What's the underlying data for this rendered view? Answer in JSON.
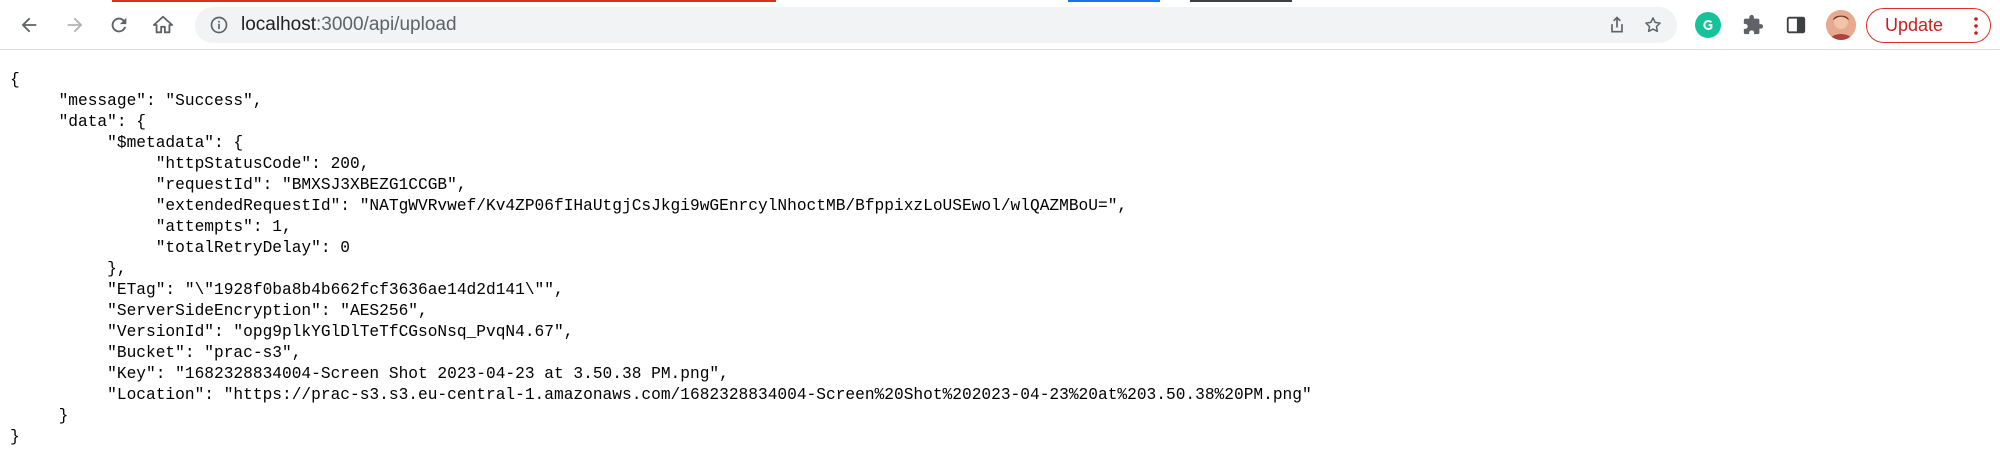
{
  "browser": {
    "url_host": "localhost",
    "url_path": ":3000/api/upload",
    "update_label": "Update",
    "icons": {
      "back": "back-arrow-icon",
      "forward": "forward-arrow-icon",
      "reload": "reload-icon",
      "home": "home-icon",
      "site_info": "info-icon",
      "share": "share-icon",
      "bookmark": "star-icon",
      "grammarly": "grammarly-icon",
      "extensions": "puzzle-icon",
      "side_panel": "side-panel-icon",
      "more": "more-vertical-icon"
    },
    "tab_colors": [
      "#d93025",
      "#1a73e8",
      "#3c4043"
    ]
  },
  "json_lines": [
    "{",
    "     \"message\": \"Success\",",
    "     \"data\": {",
    "          \"$metadata\": {",
    "               \"httpStatusCode\": 200,",
    "               \"requestId\": \"BMXSJ3XBEZG1CCGB\",",
    "               \"extendedRequestId\": \"NATgWVRvwef/Kv4ZP06fIHaUtgjCsJkgi9wGEnrcylNhoctMB/BfppixzLoUSEwol/wlQAZMBoU=\",",
    "               \"attempts\": 1,",
    "               \"totalRetryDelay\": 0",
    "          },",
    "          \"ETag\": \"\\\"1928f0ba8b4b662fcf3636ae14d2d141\\\"\",",
    "          \"ServerSideEncryption\": \"AES256\",",
    "          \"VersionId\": \"opg9plkYGlDlTeTfCGsoNsq_PvqN4.67\",",
    "          \"Bucket\": \"prac-s3\",",
    "          \"Key\": \"1682328834004-Screen Shot 2023-04-23 at 3.50.38 PM.png\",",
    "          \"Location\": \"https://prac-s3.s3.eu-central-1.amazonaws.com/1682328834004-Screen%20Shot%202023-04-23%20at%203.50.38%20PM.png\"",
    "     }",
    "}"
  ]
}
